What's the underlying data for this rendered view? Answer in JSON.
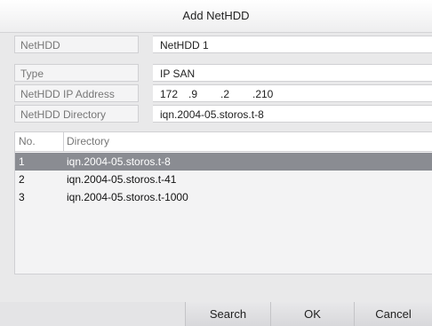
{
  "dialog": {
    "title": "Add NetHDD"
  },
  "fields": {
    "nethdd": {
      "label": "NetHDD",
      "value": "NetHDD 1"
    },
    "type": {
      "label": "Type",
      "value": "IP SAN"
    },
    "ip": {
      "label": "NetHDD IP Address",
      "octets": [
        "172",
        ".9",
        ".2",
        ".210"
      ]
    },
    "directory": {
      "label": "NetHDD Directory",
      "value": "iqn.2004-05.storos.t-8"
    }
  },
  "table": {
    "columns": {
      "no": "No.",
      "directory": "Directory"
    },
    "rows": [
      {
        "no": "1",
        "directory": "iqn.2004-05.storos.t-8",
        "selected": true
      },
      {
        "no": "2",
        "directory": "iqn.2004-05.storos.t-41",
        "selected": false
      },
      {
        "no": "3",
        "directory": "iqn.2004-05.storos.t-1000",
        "selected": false
      }
    ]
  },
  "buttons": {
    "search": "Search",
    "ok": "OK",
    "cancel": "Cancel"
  },
  "icons": {
    "dropdown": "chevron-down-icon"
  }
}
